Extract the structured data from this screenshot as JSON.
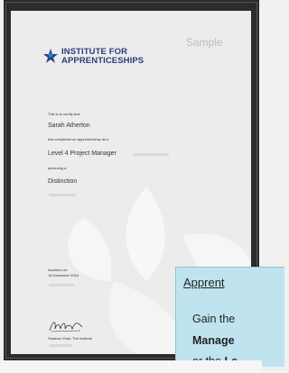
{
  "certificate": {
    "logo_line1": "INSTITUTE FOR",
    "logo_line2": "APPRENTICESHIPS",
    "watermark": "Sample",
    "certify_text": "This is to certify that",
    "recipient_name": "Sarah Atherton",
    "completed_text": "has completed an apprenticeship as a",
    "apprenticeship_title": "Level 4 Project Manager",
    "achieving_text": "achieving a",
    "grade": "Distinction",
    "awarded_label": "Awarded on:",
    "awarded_date": "16 December 2016",
    "signatory": "Shadow Chair, The Institute",
    "colors": {
      "logo_blue": "#2a3d7a",
      "accent_blue": "#1e88c8",
      "panel_bg": "#bfe4ef"
    }
  },
  "info_panel": {
    "title": "Apprent",
    "line1": "Gain the",
    "line2": "Manage",
    "line3_prefix": "or the ",
    "line3_bold": "Le"
  }
}
